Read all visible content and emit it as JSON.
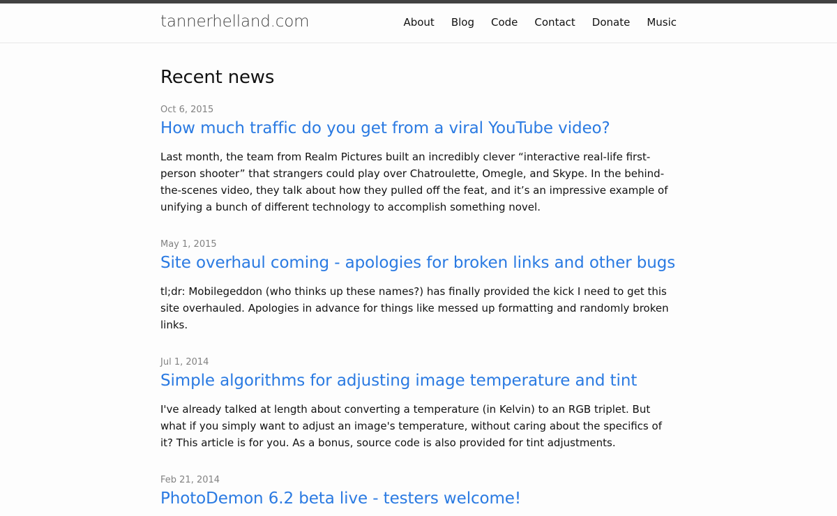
{
  "header": {
    "site_title": "tannerhelland.com",
    "nav": [
      "About",
      "Blog",
      "Code",
      "Contact",
      "Donate",
      "Music"
    ]
  },
  "main": {
    "heading": "Recent news",
    "posts": [
      {
        "date": "Oct 6, 2015",
        "title": "How much traffic do you get from a viral YouTube video?",
        "excerpt": "Last month, the team from Realm Pictures built an incredibly clever “interactive real-life first-person shooter” that strangers could play over Chatroulette, Omegle, and Skype. In the behind-the-scenes video, they talk about how they pulled off the feat, and it’s an impressive example of unifying a bunch of different technology to accomplish something novel."
      },
      {
        "date": "May 1, 2015",
        "title": "Site overhaul coming - apologies for broken links and other bugs",
        "excerpt": "tl;dr: Mobilegeddon (who thinks up these names?) has finally provided the kick I need to get this site overhauled. Apologies in advance for things like messed up formatting and randomly broken links."
      },
      {
        "date": "Jul 1, 2014",
        "title": "Simple algorithms for adjusting image temperature and tint",
        "excerpt": "I've already talked at length about converting a temperature (in Kelvin) to an RGB triplet. But what if you simply want to adjust an image's temperature, without caring about the specifics of it? This article is for you. As a bonus, source code is also provided for tint adjustments."
      },
      {
        "date": "Feb 21, 2014",
        "title": "PhotoDemon 6.2 beta live - testers welcome!",
        "excerpt": ""
      }
    ]
  },
  "colors": {
    "link": "#2a7ae2",
    "meta": "#828282",
    "topbar": "#424242"
  }
}
